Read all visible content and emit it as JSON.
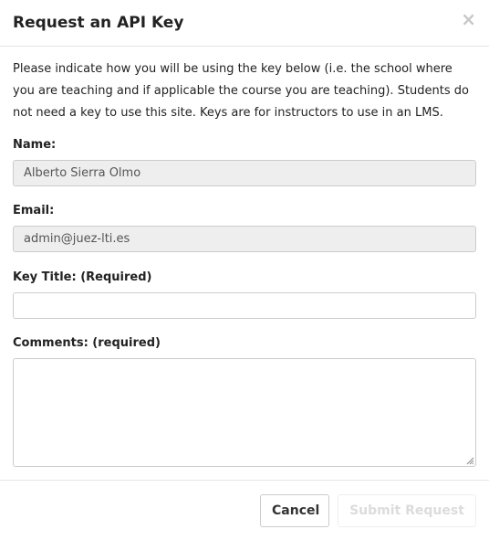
{
  "modal": {
    "title": "Request an API Key",
    "close_label": "×"
  },
  "body": {
    "intro": "Please indicate how you will be using the key below (i.e. the school where you are teaching and if applicable the course you are teaching). Students do not need a key to use this site. Keys are for instructors to use in an LMS."
  },
  "form": {
    "name_label": "Name:",
    "name_value": "Alberto Sierra Olmo",
    "email_label": "Email:",
    "email_value": "admin@juez-lti.es",
    "key_title_label": "Key Title: (Required)",
    "key_title_value": "",
    "comments_label": "Comments: (required)",
    "comments_value": ""
  },
  "footer": {
    "cancel_label": "Cancel",
    "submit_label": "Submit Request"
  }
}
